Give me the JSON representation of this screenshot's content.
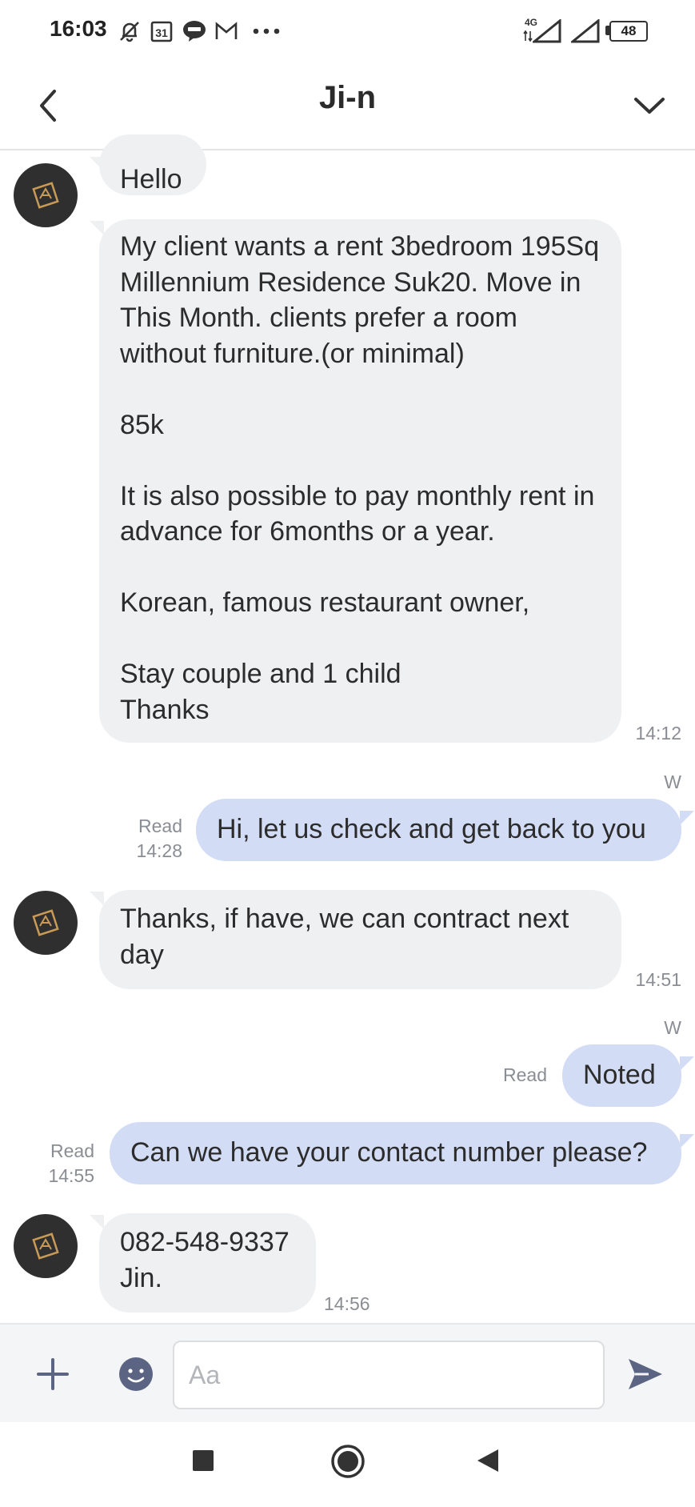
{
  "status_bar": {
    "time": "16:03",
    "icons": [
      "notifications-off-icon",
      "calendar-icon",
      "line-app-icon",
      "gmail-icon",
      "more-dots-icon"
    ],
    "calendar_day": "31",
    "network": "4G",
    "battery": "48"
  },
  "header": {
    "title": "Ji-n",
    "back_icon": "chevron-left-icon",
    "expand_icon": "chevron-down-icon"
  },
  "messages": [
    {
      "id": "m1",
      "direction": "in",
      "text": "Hello"
    },
    {
      "id": "m2",
      "direction": "in",
      "text": "My client wants a rent 3bedroom 195Sq Millennium Residence Suk20. Move in This Month. clients prefer a room without furniture.(or minimal)\n\n85k\n\nIt is also possible to pay monthly rent in advance for 6months or a year.\n\nKorean, famous restaurant owner,\n\nStay couple and 1 child\nThanks",
      "time": "14:12"
    },
    {
      "id": "m3",
      "direction": "out",
      "sender_label": "W",
      "text": "Hi, let us check and get back to you",
      "read": "Read",
      "time": "14:28"
    },
    {
      "id": "m4",
      "direction": "in",
      "text": "Thanks, if have, we can contract next day",
      "time": "14:51"
    },
    {
      "id": "m5",
      "direction": "out",
      "sender_label": "W",
      "text": "Noted",
      "read": "Read"
    },
    {
      "id": "m6",
      "direction": "out",
      "text": "Can we have your contact number please?",
      "read": "Read",
      "time": "14:55"
    },
    {
      "id": "m7",
      "direction": "in",
      "text": "082-548-9337\nJin.",
      "time": "14:56"
    }
  ],
  "input_bar": {
    "placeholder": "Aa",
    "add_icon": "plus-icon",
    "emoji_icon": "emoji-icon",
    "send_icon": "send-icon"
  },
  "nav_bar": {
    "icons": [
      "recents-square-icon",
      "home-circle-icon",
      "back-triangle-icon"
    ]
  },
  "colors": {
    "incoming_bubble": "#eff0f2",
    "outgoing_bubble": "#d2dcf4",
    "accent_icon": "#5b6482",
    "meta_text": "#8a8d93"
  }
}
